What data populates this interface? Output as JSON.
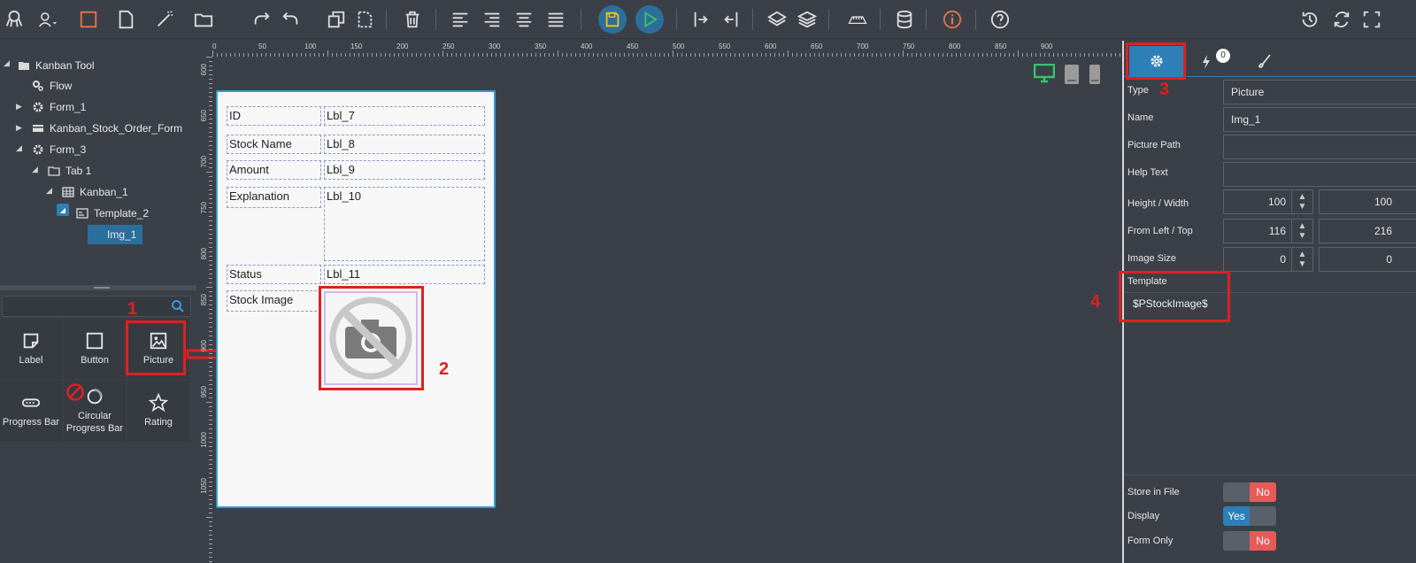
{
  "tree": {
    "root": "Kanban Tool",
    "flow": "Flow",
    "form1": "Form_1",
    "kanban_form": "Kanban_Stock_Order_Form",
    "form3": "Form_3",
    "tab1": "Tab 1",
    "kanban1": "Kanban_1",
    "template2": "Template_2",
    "img1": "Img_1"
  },
  "components": [
    {
      "label": "Label"
    },
    {
      "label": "Button"
    },
    {
      "label": "Picture"
    },
    {
      "label": "Progress Bar"
    },
    {
      "label": "Circular Progress Bar"
    },
    {
      "label": "Rating"
    }
  ],
  "ruler": {
    "ticks": [
      "0",
      "50",
      "100",
      "150",
      "200",
      "250",
      "300",
      "350",
      "400",
      "450",
      "500",
      "550",
      "600",
      "650",
      "700",
      "750",
      "800",
      "850",
      "900"
    ],
    "vticks": [
      "600",
      "650",
      "700",
      "750",
      "800",
      "850",
      "900",
      "950",
      "1000",
      "1050"
    ]
  },
  "form": {
    "rows": [
      {
        "label": "ID",
        "value": "Lbl_7"
      },
      {
        "label": "Stock Name",
        "value": "Lbl_8"
      },
      {
        "label": "Amount",
        "value": "Lbl_9"
      },
      {
        "label": "Explanation",
        "value": "Lbl_10"
      },
      {
        "label": "Status",
        "value": "Lbl_11"
      },
      {
        "label": "Stock Image",
        "value": ""
      }
    ]
  },
  "annotations": {
    "n1": "1",
    "n2": "2",
    "n3": "3",
    "n4": "4"
  },
  "props": {
    "event_count": "0",
    "type_label": "Type",
    "type_value": "Picture",
    "name_label": "Name",
    "name_value": "Img_1",
    "path_label": "Picture Path",
    "path_value": "",
    "help_label": "Help Text",
    "help_value": "",
    "hw_label": "Height / Width",
    "height": "100",
    "width": "100",
    "lt_label": "From Left / Top",
    "left": "116",
    "top": "216",
    "size_label": "Image Size",
    "size1": "0",
    "size2": "0",
    "template_label": "Template",
    "template_value": "$PStockImage$",
    "store_label": "Store in File",
    "store_value": "No",
    "display_label": "Display",
    "display_value": "Yes",
    "formonly_label": "Form Only",
    "formonly_value": "No"
  },
  "colors": {
    "accent": "#2d7fb8",
    "red": "#e02020",
    "no": "#e85a5a",
    "yes": "#2d7fb8"
  }
}
